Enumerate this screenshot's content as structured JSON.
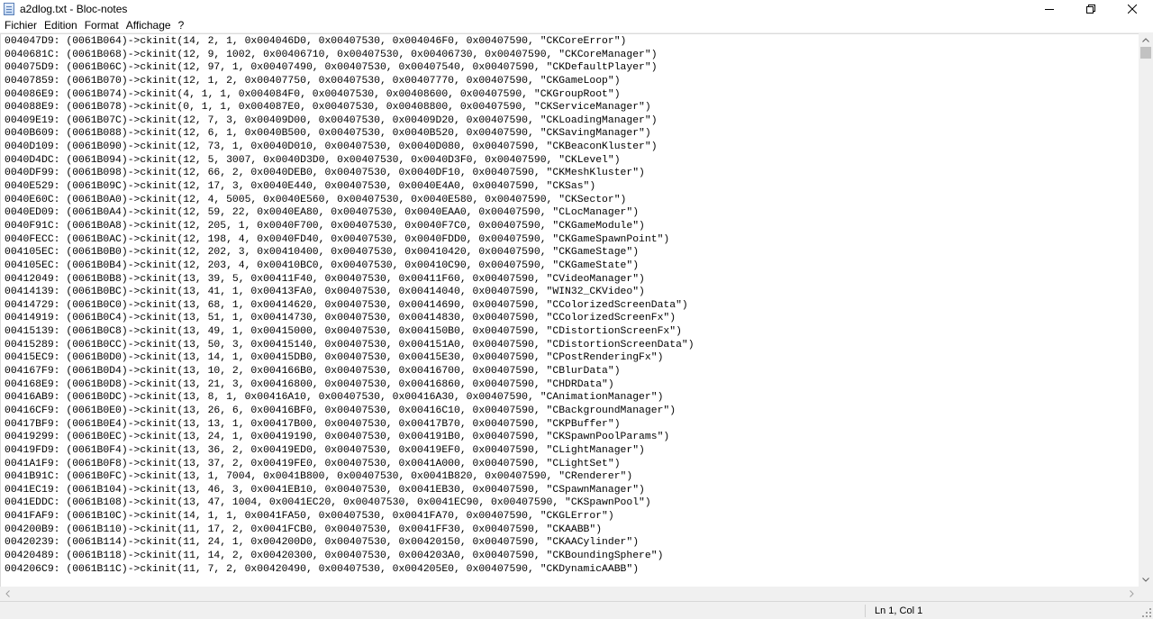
{
  "window": {
    "title": "a2dlog.txt - Bloc-notes",
    "icon": "notepad-icon"
  },
  "controls": {
    "minimize": "minimize-icon",
    "maximize": "maximize-icon",
    "close": "close-icon"
  },
  "menu": [
    {
      "label": "Fichier"
    },
    {
      "label": "Edition"
    },
    {
      "label": "Format"
    },
    {
      "label": "Affichage"
    },
    {
      "label": "?"
    }
  ],
  "lines": [
    "004047D9: (0061B064)->ckinit(14, 2, 1, 0x004046D0, 0x00407530, 0x004046F0, 0x00407590, \"CKCoreError\")",
    "0040681C: (0061B068)->ckinit(12, 9, 1002, 0x00406710, 0x00407530, 0x00406730, 0x00407590, \"CKCoreManager\")",
    "004075D9: (0061B06C)->ckinit(12, 97, 1, 0x00407490, 0x00407530, 0x00407540, 0x00407590, \"CKDefaultPlayer\")",
    "00407859: (0061B070)->ckinit(12, 1, 2, 0x00407750, 0x00407530, 0x00407770, 0x00407590, \"CKGameLoop\")",
    "004086E9: (0061B074)->ckinit(4, 1, 1, 0x004084F0, 0x00407530, 0x00408600, 0x00407590, \"CKGroupRoot\")",
    "004088E9: (0061B078)->ckinit(0, 1, 1, 0x004087E0, 0x00407530, 0x00408800, 0x00407590, \"CKServiceManager\")",
    "00409E19: (0061B07C)->ckinit(12, 7, 3, 0x00409D00, 0x00407530, 0x00409D20, 0x00407590, \"CKLoadingManager\")",
    "0040B609: (0061B088)->ckinit(12, 6, 1, 0x0040B500, 0x00407530, 0x0040B520, 0x00407590, \"CKSavingManager\")",
    "0040D109: (0061B090)->ckinit(12, 73, 1, 0x0040D010, 0x00407530, 0x0040D080, 0x00407590, \"CKBeaconKluster\")",
    "0040D4DC: (0061B094)->ckinit(12, 5, 3007, 0x0040D3D0, 0x00407530, 0x0040D3F0, 0x00407590, \"CKLevel\")",
    "0040DF99: (0061B098)->ckinit(12, 66, 2, 0x0040DEB0, 0x00407530, 0x0040DF10, 0x00407590, \"CKMeshKluster\")",
    "0040E529: (0061B09C)->ckinit(12, 17, 3, 0x0040E440, 0x00407530, 0x0040E4A0, 0x00407590, \"CKSas\")",
    "0040E60C: (0061B0A0)->ckinit(12, 4, 5005, 0x0040E560, 0x00407530, 0x0040E580, 0x00407590, \"CKSector\")",
    "0040ED09: (0061B0A4)->ckinit(12, 59, 22, 0x0040EA80, 0x00407530, 0x0040EAA0, 0x00407590, \"CLocManager\")",
    "0040F91C: (0061B0A8)->ckinit(12, 205, 1, 0x0040F700, 0x00407530, 0x0040F7C0, 0x00407590, \"CKGameModule\")",
    "0040FECC: (0061B0AC)->ckinit(12, 198, 4, 0x0040FD40, 0x00407530, 0x0040FDD0, 0x00407590, \"CKGameSpawnPoint\")",
    "004105EC: (0061B0B0)->ckinit(12, 202, 3, 0x00410400, 0x00407530, 0x00410420, 0x00407590, \"CKGameStage\")",
    "004105EC: (0061B0B4)->ckinit(12, 203, 4, 0x00410BC0, 0x00407530, 0x00410C90, 0x00407590, \"CKGameState\")",
    "00412049: (0061B0B8)->ckinit(13, 39, 5, 0x00411F40, 0x00407530, 0x00411F60, 0x00407590, \"CVideoManager\")",
    "00414139: (0061B0BC)->ckinit(13, 41, 1, 0x00413FA0, 0x00407530, 0x00414040, 0x00407590, \"WIN32_CKVideo\")",
    "00414729: (0061B0C0)->ckinit(13, 68, 1, 0x00414620, 0x00407530, 0x00414690, 0x00407590, \"CColorizedScreenData\")",
    "00414919: (0061B0C4)->ckinit(13, 51, 1, 0x00414730, 0x00407530, 0x00414830, 0x00407590, \"CColorizedScreenFx\")",
    "00415139: (0061B0C8)->ckinit(13, 49, 1, 0x00415000, 0x00407530, 0x004150B0, 0x00407590, \"CDistortionScreenFx\")",
    "00415289: (0061B0CC)->ckinit(13, 50, 3, 0x00415140, 0x00407530, 0x004151A0, 0x00407590, \"CDistortionScreenData\")",
    "00415EC9: (0061B0D0)->ckinit(13, 14, 1, 0x00415DB0, 0x00407530, 0x00415E30, 0x00407590, \"CPostRenderingFx\")",
    "004167F9: (0061B0D4)->ckinit(13, 10, 2, 0x004166B0, 0x00407530, 0x00416700, 0x00407590, \"CBlurData\")",
    "004168E9: (0061B0D8)->ckinit(13, 21, 3, 0x00416800, 0x00407530, 0x00416860, 0x00407590, \"CHDRData\")",
    "00416AB9: (0061B0DC)->ckinit(13, 8, 1, 0x00416A10, 0x00407530, 0x00416A30, 0x00407590, \"CAnimationManager\")",
    "00416CF9: (0061B0E0)->ckinit(13, 26, 6, 0x00416BF0, 0x00407530, 0x00416C10, 0x00407590, \"CBackgroundManager\")",
    "00417BF9: (0061B0E4)->ckinit(13, 13, 1, 0x00417B00, 0x00407530, 0x00417B70, 0x00407590, \"CKPBuffer\")",
    "00419299: (0061B0EC)->ckinit(13, 24, 1, 0x00419190, 0x00407530, 0x004191B0, 0x00407590, \"CKSpawnPoolParams\")",
    "00419FD9: (0061B0F4)->ckinit(13, 36, 2, 0x00419ED0, 0x00407530, 0x00419EF0, 0x00407590, \"CLightManager\")",
    "0041A1F9: (0061B0F8)->ckinit(13, 37, 2, 0x00419FE0, 0x00407530, 0x0041A000, 0x00407590, \"CLightSet\")",
    "0041B91C: (0061B0FC)->ckinit(13, 1, 7004, 0x0041B800, 0x00407530, 0x0041B820, 0x00407590, \"CRenderer\")",
    "0041EC19: (0061B104)->ckinit(13, 46, 3, 0x0041EB10, 0x00407530, 0x0041EB30, 0x00407590, \"CSpawnManager\")",
    "0041EDDC: (0061B108)->ckinit(13, 47, 1004, 0x0041EC20, 0x00407530, 0x0041EC90, 0x00407590, \"CKSpawnPool\")",
    "0041FAF9: (0061B10C)->ckinit(14, 1, 1, 0x0041FA50, 0x00407530, 0x0041FA70, 0x00407590, \"CKGLError\")",
    "004200B9: (0061B110)->ckinit(11, 17, 2, 0x0041FCB0, 0x00407530, 0x0041FF30, 0x00407590, \"CKAABB\")",
    "00420239: (0061B114)->ckinit(11, 24, 1, 0x004200D0, 0x00407530, 0x00420150, 0x00407590, \"CKAACylinder\")",
    "00420489: (0061B118)->ckinit(11, 14, 2, 0x00420300, 0x00407530, 0x004203A0, 0x00407590, \"CKBoundingSphere\")",
    "004206C9: (0061B11C)->ckinit(11, 7, 2, 0x00420490, 0x00407530, 0x004205E0, 0x00407590, \"CKDynamicAABB\")"
  ],
  "status": {
    "position": "Ln 1, Col 1"
  }
}
